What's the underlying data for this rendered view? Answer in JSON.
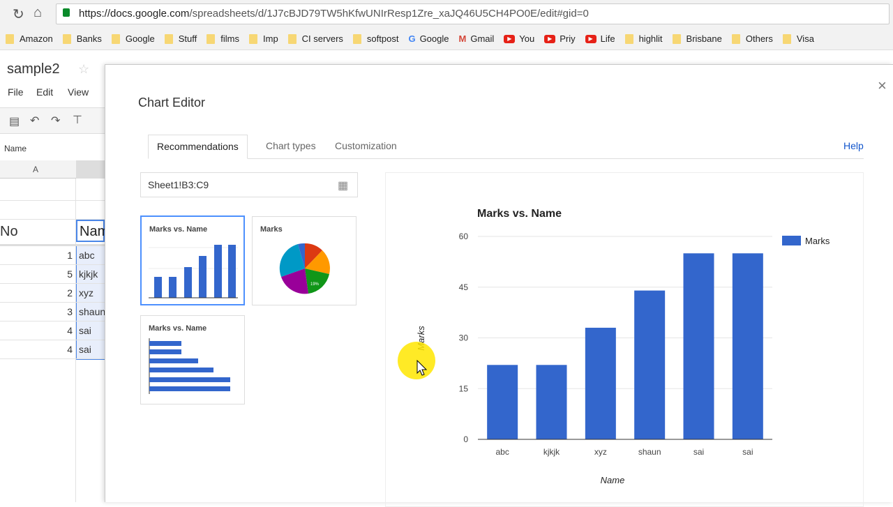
{
  "browser": {
    "url_host": "https://docs.google.com",
    "url_path": "/spreadsheets/d/1J7cBJD79TW5hKfwUNIrResp1Zre_xaJQ46U5CH4PO0E/edit#gid=0",
    "bookmarks": [
      {
        "label": "Amazon",
        "icon": "folder"
      },
      {
        "label": "Banks",
        "icon": "folder"
      },
      {
        "label": "Google",
        "icon": "folder"
      },
      {
        "label": "Stuff",
        "icon": "folder"
      },
      {
        "label": "films",
        "icon": "folder"
      },
      {
        "label": "Imp",
        "icon": "folder"
      },
      {
        "label": "CI servers",
        "icon": "folder"
      },
      {
        "label": "softpost",
        "icon": "folder"
      },
      {
        "label": "Google",
        "icon": "google"
      },
      {
        "label": "Gmail",
        "icon": "gmail"
      },
      {
        "label": "You",
        "icon": "youtube"
      },
      {
        "label": "Priy",
        "icon": "youtube"
      },
      {
        "label": "Life",
        "icon": "youtube"
      },
      {
        "label": "highlit",
        "icon": "folder"
      },
      {
        "label": "Brisbane",
        "icon": "folder"
      },
      {
        "label": "Others",
        "icon": "folder"
      },
      {
        "label": "Visa",
        "icon": "folder"
      }
    ]
  },
  "sheet": {
    "title": "sample2",
    "menu": [
      "File",
      "Edit",
      "View"
    ],
    "formula_bar": "Name",
    "col_a": "A",
    "header_no": "No",
    "header_name": "Nam",
    "rows": [
      {
        "no": "1",
        "name": "abc"
      },
      {
        "no": "5",
        "name": "kjkjk"
      },
      {
        "no": "2",
        "name": "xyz"
      },
      {
        "no": "3",
        "name": "shaun"
      },
      {
        "no": "4",
        "name": "sai"
      },
      {
        "no": "4",
        "name": "sai"
      }
    ]
  },
  "editor": {
    "title": "Chart Editor",
    "close": "×",
    "tabs": [
      "Recommendations",
      "Chart types",
      "Customization"
    ],
    "help": "Help",
    "range": "Sheet1!B3:C9",
    "thumbs": [
      {
        "title": "Marks vs. Name"
      },
      {
        "title": "Marks"
      },
      {
        "title": "Marks vs. Name"
      }
    ],
    "pie_label": "19%"
  },
  "chart_data": {
    "type": "bar",
    "title": "Marks vs. Name",
    "xlabel": "Name",
    "ylabel": "Marks",
    "categories": [
      "abc",
      "kjkjk",
      "xyz",
      "shaun",
      "sai",
      "sai"
    ],
    "series": [
      {
        "name": "Marks",
        "values": [
          22,
          22,
          33,
          44,
          55,
          55
        ]
      }
    ],
    "ylim": [
      0,
      60
    ],
    "yticks": [
      0,
      15,
      30,
      45,
      60
    ],
    "legend": "right",
    "grid": true,
    "color": "#3366cc"
  }
}
